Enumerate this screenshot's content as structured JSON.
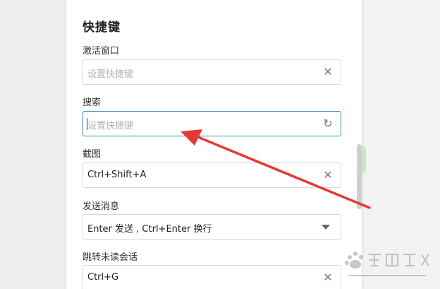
{
  "settings": {
    "section_title": "快捷键",
    "fields": [
      {
        "label": "激活窗口",
        "value": "",
        "placeholder": "设置快捷键",
        "icon": "close-icon",
        "glyph": "✕"
      },
      {
        "label": "搜索",
        "value": "",
        "placeholder": "设置快捷键",
        "icon": "reset-icon",
        "glyph": "↻"
      },
      {
        "label": "截图",
        "value": "Ctrl+Shift+A",
        "placeholder": "",
        "icon": "close-icon",
        "glyph": "✕"
      },
      {
        "label": "发送消息",
        "value": "Enter 发送 , Ctrl+Enter 换行",
        "placeholder": "",
        "icon": "dropdown-arrow-icon",
        "glyph": ""
      },
      {
        "label": "跳转未读会话",
        "value": "Ctrl+G",
        "placeholder": "",
        "icon": "close-icon",
        "glyph": "✕"
      }
    ]
  },
  "annotation": {
    "color": "#e53935"
  }
}
